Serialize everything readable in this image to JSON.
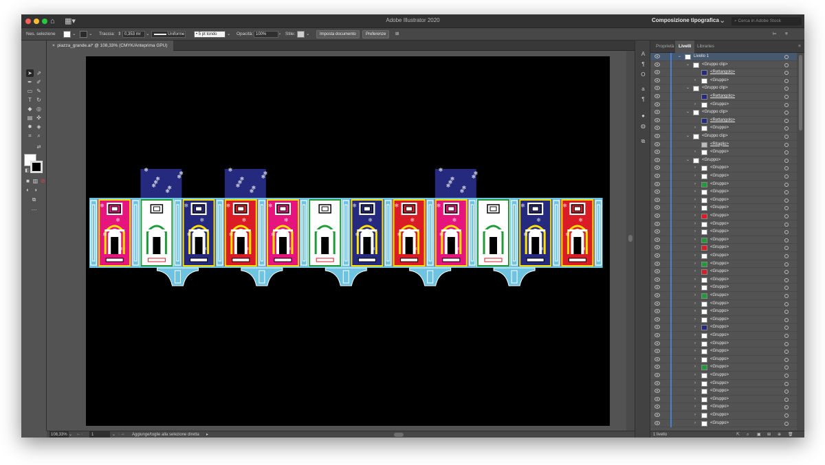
{
  "app": {
    "title": "Adobe Illustrator 2020",
    "workspace": "Composizione tipografica",
    "stock_placeholder": "Cerca in Adobe Stock"
  },
  "control": {
    "selection": "Nes. selezione",
    "stroke_label": "Traccia:",
    "stroke_value": "0,353 mr",
    "profile": "Uniforme",
    "brush": "5 pt tondo",
    "opacity_label": "Opacità:",
    "opacity_value": "100%",
    "style_label": "Stile:",
    "doc_setup": "Imposta documento",
    "prefs": "Preferenze"
  },
  "document": {
    "tab": "piazza_grande.ai* @ 108,33% (CMYK/Anteprima GPU)"
  },
  "status": {
    "zoom": "108,33%",
    "artboard": "1",
    "hint": "Aggiunge/toglie alla selezione diretta"
  },
  "panel": {
    "tabs": [
      "Proprietà",
      "Livelli",
      "Libraries"
    ],
    "active_tab": 1,
    "footer": "1 livello",
    "layers": [
      {
        "name": "Livello 1",
        "depth": 0,
        "arrow": "open",
        "thumb": "layer",
        "selected": true
      },
      {
        "name": "<Gruppo clip>",
        "depth": 1,
        "arrow": "open",
        "thumb": "white"
      },
      {
        "name": "<Rettangolo>",
        "depth": 2,
        "arrow": "none",
        "thumb": "navy",
        "underline": true
      },
      {
        "name": "<Gruppo>",
        "depth": 2,
        "arrow": "closed",
        "thumb": "white"
      },
      {
        "name": "<Gruppo clip>",
        "depth": 1,
        "arrow": "open",
        "thumb": "white"
      },
      {
        "name": "<Rettangolo>",
        "depth": 2,
        "arrow": "none",
        "thumb": "navy",
        "underline": true
      },
      {
        "name": "<Gruppo>",
        "depth": 2,
        "arrow": "closed",
        "thumb": "white"
      },
      {
        "name": "<Gruppo clip>",
        "depth": 1,
        "arrow": "open",
        "thumb": "white"
      },
      {
        "name": "<Rettangolo>",
        "depth": 2,
        "arrow": "none",
        "thumb": "navy",
        "underline": true
      },
      {
        "name": "<Gruppo>",
        "depth": 2,
        "arrow": "closed",
        "thumb": "white"
      },
      {
        "name": "<Gruppo clip>",
        "depth": 1,
        "arrow": "open",
        "thumb": "white"
      },
      {
        "name": "<Ritaglio>",
        "depth": 2,
        "arrow": "none",
        "thumb": "gray",
        "underline": true
      },
      {
        "name": "<Gruppo>",
        "depth": 2,
        "arrow": "closed",
        "thumb": "white"
      },
      {
        "name": "<Gruppo>",
        "depth": 1,
        "arrow": "open",
        "thumb": "white"
      },
      {
        "name": "<Gruppo>",
        "depth": 2,
        "arrow": "closed",
        "thumb": "white"
      },
      {
        "name": "<Gruppo>",
        "depth": 2,
        "arrow": "closed",
        "thumb": "white"
      },
      {
        "name": "<Gruppo>",
        "depth": 2,
        "arrow": "closed",
        "thumb": "green"
      },
      {
        "name": "<Gruppo>",
        "depth": 2,
        "arrow": "closed",
        "thumb": "white"
      },
      {
        "name": "<Gruppo>",
        "depth": 2,
        "arrow": "closed",
        "thumb": "white"
      },
      {
        "name": "<Gruppo>",
        "depth": 2,
        "arrow": "closed",
        "thumb": "white"
      },
      {
        "name": "<Gruppo>",
        "depth": 2,
        "arrow": "closed",
        "thumb": "red"
      },
      {
        "name": "<Gruppo>",
        "depth": 2,
        "arrow": "closed",
        "thumb": "white"
      },
      {
        "name": "<Gruppo>",
        "depth": 2,
        "arrow": "closed",
        "thumb": "white"
      },
      {
        "name": "<Gruppo>",
        "depth": 2,
        "arrow": "closed",
        "thumb": "green"
      },
      {
        "name": "<Gruppo>",
        "depth": 2,
        "arrow": "closed",
        "thumb": "red"
      },
      {
        "name": "<Gruppo>",
        "depth": 2,
        "arrow": "closed",
        "thumb": "white"
      },
      {
        "name": "<Gruppo>",
        "depth": 2,
        "arrow": "closed",
        "thumb": "green"
      },
      {
        "name": "<Gruppo>",
        "depth": 2,
        "arrow": "closed",
        "thumb": "red"
      },
      {
        "name": "<Gruppo>",
        "depth": 2,
        "arrow": "closed",
        "thumb": "white"
      },
      {
        "name": "<Gruppo>",
        "depth": 2,
        "arrow": "closed",
        "thumb": "white"
      },
      {
        "name": "<Gruppo>",
        "depth": 2,
        "arrow": "closed",
        "thumb": "green"
      },
      {
        "name": "<Gruppo>",
        "depth": 2,
        "arrow": "closed",
        "thumb": "white"
      },
      {
        "name": "<Gruppo>",
        "depth": 2,
        "arrow": "closed",
        "thumb": "white"
      },
      {
        "name": "<Gruppo>",
        "depth": 2,
        "arrow": "closed",
        "thumb": "white"
      },
      {
        "name": "<Gruppo>",
        "depth": 2,
        "arrow": "closed",
        "thumb": "navy"
      },
      {
        "name": "<Gruppo>",
        "depth": 2,
        "arrow": "closed",
        "thumb": "white"
      },
      {
        "name": "<Gruppo>",
        "depth": 2,
        "arrow": "closed",
        "thumb": "white"
      },
      {
        "name": "<Gruppo>",
        "depth": 2,
        "arrow": "closed",
        "thumb": "white"
      },
      {
        "name": "<Gruppo>",
        "depth": 2,
        "arrow": "closed",
        "thumb": "white"
      },
      {
        "name": "<Gruppo>",
        "depth": 2,
        "arrow": "closed",
        "thumb": "green"
      },
      {
        "name": "<Gruppo>",
        "depth": 2,
        "arrow": "closed",
        "thumb": "white"
      },
      {
        "name": "<Gruppo>",
        "depth": 2,
        "arrow": "closed",
        "thumb": "white"
      },
      {
        "name": "<Gruppo>",
        "depth": 2,
        "arrow": "closed",
        "thumb": "white"
      },
      {
        "name": "<Gruppo>",
        "depth": 2,
        "arrow": "closed",
        "thumb": "white"
      },
      {
        "name": "<Gruppo>",
        "depth": 2,
        "arrow": "closed",
        "thumb": "white"
      },
      {
        "name": "<Gruppo>",
        "depth": 2,
        "arrow": "closed",
        "thumb": "white"
      },
      {
        "name": "<Gruppo>",
        "depth": 2,
        "arrow": "closed",
        "thumb": "white"
      }
    ]
  },
  "artwork": {
    "palette": {
      "cyan": "#6ec4e0",
      "white": "#ffffff",
      "navy": "#252a7e",
      "pink": "#e6157d",
      "green": "#1f9b3a",
      "red": "#d91c25",
      "yellow": "#ffe300",
      "black": "#000000"
    },
    "panels": [
      "pink",
      "white",
      "navy",
      "red",
      "pink",
      "white",
      "navy",
      "red",
      "pink",
      "white",
      "navy",
      "red"
    ],
    "tops": [
      1,
      3,
      8
    ],
    "brackets": [
      1,
      3,
      5,
      7,
      9
    ]
  }
}
